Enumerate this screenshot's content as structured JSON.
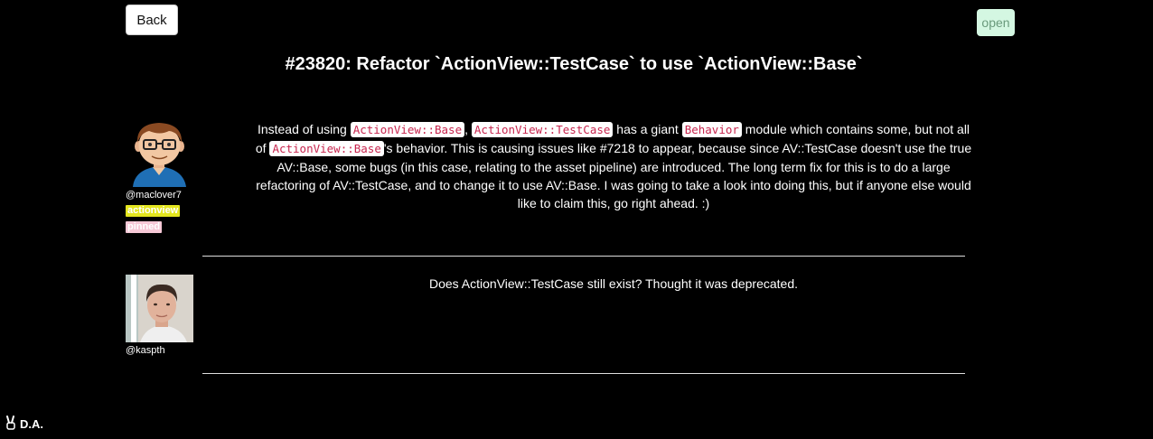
{
  "header": {
    "back_label": "Back",
    "status": "open",
    "title": "#23820: Refactor `ActionView::TestCase` to use `ActionView::Base`"
  },
  "comments": [
    {
      "username": "@maclover7",
      "labels": [
        {
          "text": "actionview",
          "color": "#e4e61e"
        },
        {
          "text": "pinned",
          "color": "#f6c8d6"
        }
      ],
      "body": {
        "t1": "Instead of using ",
        "c1": "ActionView::Base",
        "t2": ", ",
        "c2": "ActionView::TestCase",
        "t3": " has a giant ",
        "c3": "Behavior",
        "t4": " module which contains some, but not all of ",
        "c4": "ActionView::Base",
        "t5": "'s behavior. This is causing issues like #7218 to appear, because since AV::TestCase doesn't use the true AV::Base, some bugs (in this case, relating to the asset pipeline) are introduced. The long term fix for this is to do a large refactoring of AV::TestCase, and to change it to use AV::Base. I was going to take a look into doing this, but if anyone else would like to claim this, go right ahead. :)"
      }
    },
    {
      "username": "@kaspth",
      "body": "Does ActionView::TestCase still exist? Thought it was deprecated."
    }
  ],
  "footer": {
    "icon": "victory-hand-icon",
    "brand": "D.A."
  },
  "colors": {
    "background": "#000000",
    "code_text": "#c7254e",
    "status_bg": "#d4f7e2",
    "label_actionview": "#e4e61e",
    "label_pinned": "#f6c8d6"
  }
}
